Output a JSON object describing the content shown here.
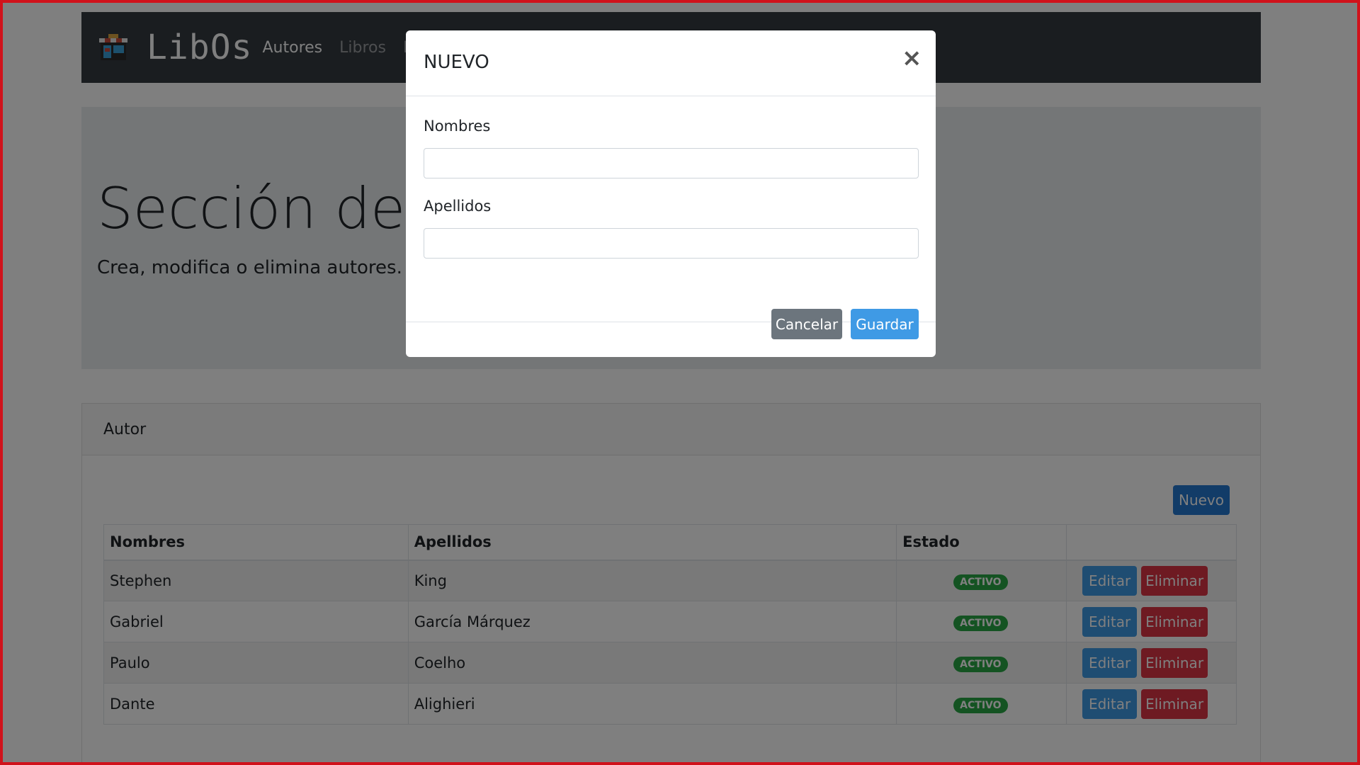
{
  "navbar": {
    "brand": "LibOs",
    "links": [
      {
        "label": "Autores"
      },
      {
        "label": "Libros"
      },
      {
        "label": "E"
      }
    ]
  },
  "jumbotron": {
    "title": "Sección de Autores",
    "lead": "Crea, modifica o elimina autores."
  },
  "card": {
    "header": "Autor",
    "new_button": "Nuevo",
    "columns": [
      "Nombres",
      "Apellidos",
      "Estado",
      ""
    ],
    "rows": [
      {
        "nombres": "Stephen",
        "apellidos": "King",
        "estado": "ACTIVO"
      },
      {
        "nombres": "Gabriel",
        "apellidos": "García Márquez",
        "estado": "ACTIVO"
      },
      {
        "nombres": "Paulo",
        "apellidos": "Coelho",
        "estado": "ACTIVO"
      },
      {
        "nombres": "Dante",
        "apellidos": "Alighieri",
        "estado": "ACTIVO"
      }
    ],
    "edit_label": "Editar",
    "delete_label": "Eliminar"
  },
  "modal": {
    "title": "NUEVO",
    "close_symbol": "×",
    "fields": [
      {
        "label": "Nombres",
        "value": ""
      },
      {
        "label": "Apellidos",
        "value": ""
      }
    ],
    "cancel_label": "Cancelar",
    "save_label": "Guardar"
  },
  "colors": {
    "navbar": "#343a40",
    "primary": "#3f9ae5",
    "danger": "#dc3545",
    "success": "#28a745",
    "secondary": "#6c757d",
    "frame": "#d0121b"
  }
}
